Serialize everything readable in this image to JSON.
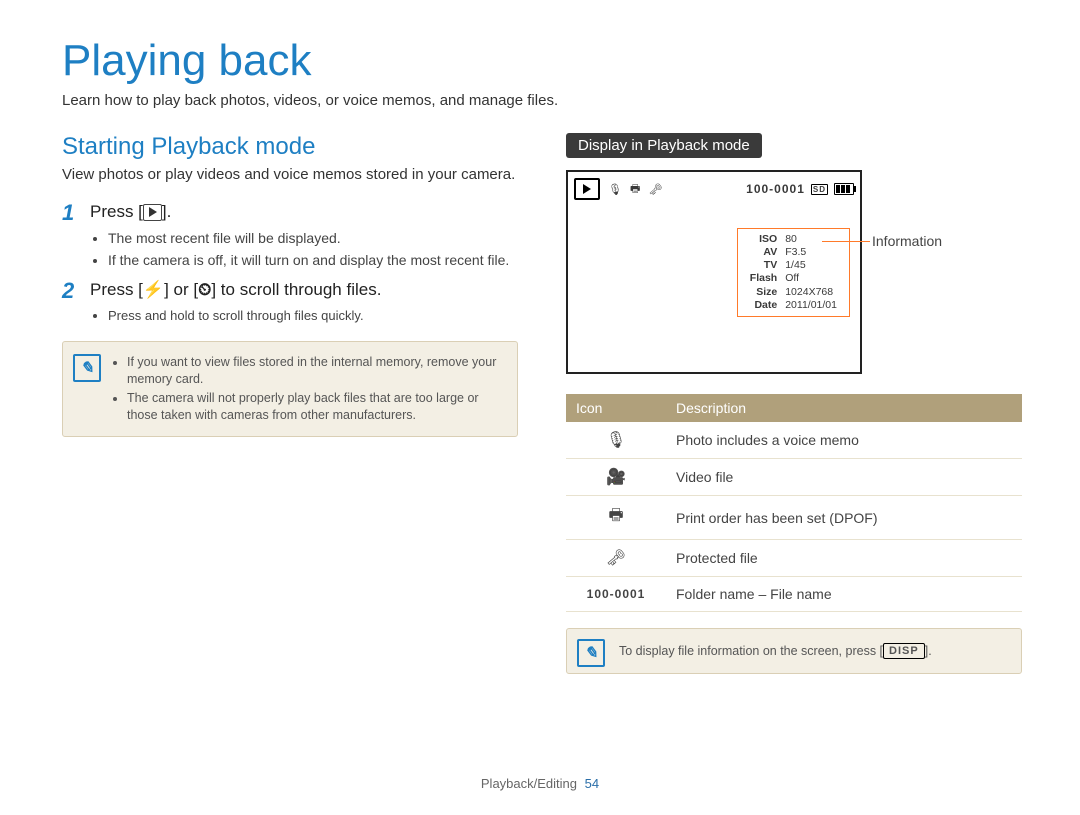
{
  "title": "Playing back",
  "intro": "Learn how to play back photos, videos, or voice memos, and manage files.",
  "left": {
    "section_title": "Starting Playback mode",
    "section_para": "View photos or play videos and voice memos stored in your camera.",
    "step1": {
      "num": "1",
      "before": "Press [",
      "after": "].",
      "bullets": [
        "The most recent file will be displayed.",
        "If the camera is off, it will turn on and display the most recent file."
      ]
    },
    "step2": {
      "num": "2",
      "before": "Press [",
      "mid": "] or [",
      "after": "] to scroll through files.",
      "flash_glyph": "⚡",
      "timer_glyph": "⏲",
      "bullet": "Press and hold to scroll through files quickly."
    },
    "note": {
      "items": [
        "If you want to view files stored in the internal memory, remove your memory card.",
        "The camera will not properly play back files that are too large or those taken with cameras from other manufacturers."
      ]
    }
  },
  "right": {
    "badge": "Display in Playback mode",
    "folder_file": "100-0001",
    "sd_label": "SD",
    "info_rows": [
      {
        "k": "ISO",
        "v": "80"
      },
      {
        "k": "AV",
        "v": "F3.5"
      },
      {
        "k": "TV",
        "v": "1/45"
      },
      {
        "k": "Flash",
        "v": "Off"
      },
      {
        "k": "Size",
        "v": "1024X768"
      },
      {
        "k": "Date",
        "v": "2011/01/01"
      }
    ],
    "callout": "Information",
    "table": {
      "head_icon": "Icon",
      "head_desc": "Description",
      "rows": [
        {
          "icon": "🎙",
          "desc": "Photo includes a voice memo"
        },
        {
          "icon": "🎥",
          "desc": "Video file"
        },
        {
          "icon": "🖶",
          "desc": "Print order has been set (DPOF)"
        },
        {
          "icon": "🗝",
          "desc": "Protected file"
        },
        {
          "icon": "100-0001",
          "desc": "Folder name – File name",
          "is_text": true
        }
      ]
    },
    "note2_before": "To display file information on the screen, press [",
    "note2_disp": "DISP",
    "note2_after": "]."
  },
  "footer": {
    "section": "Playback/Editing",
    "page": "54"
  }
}
